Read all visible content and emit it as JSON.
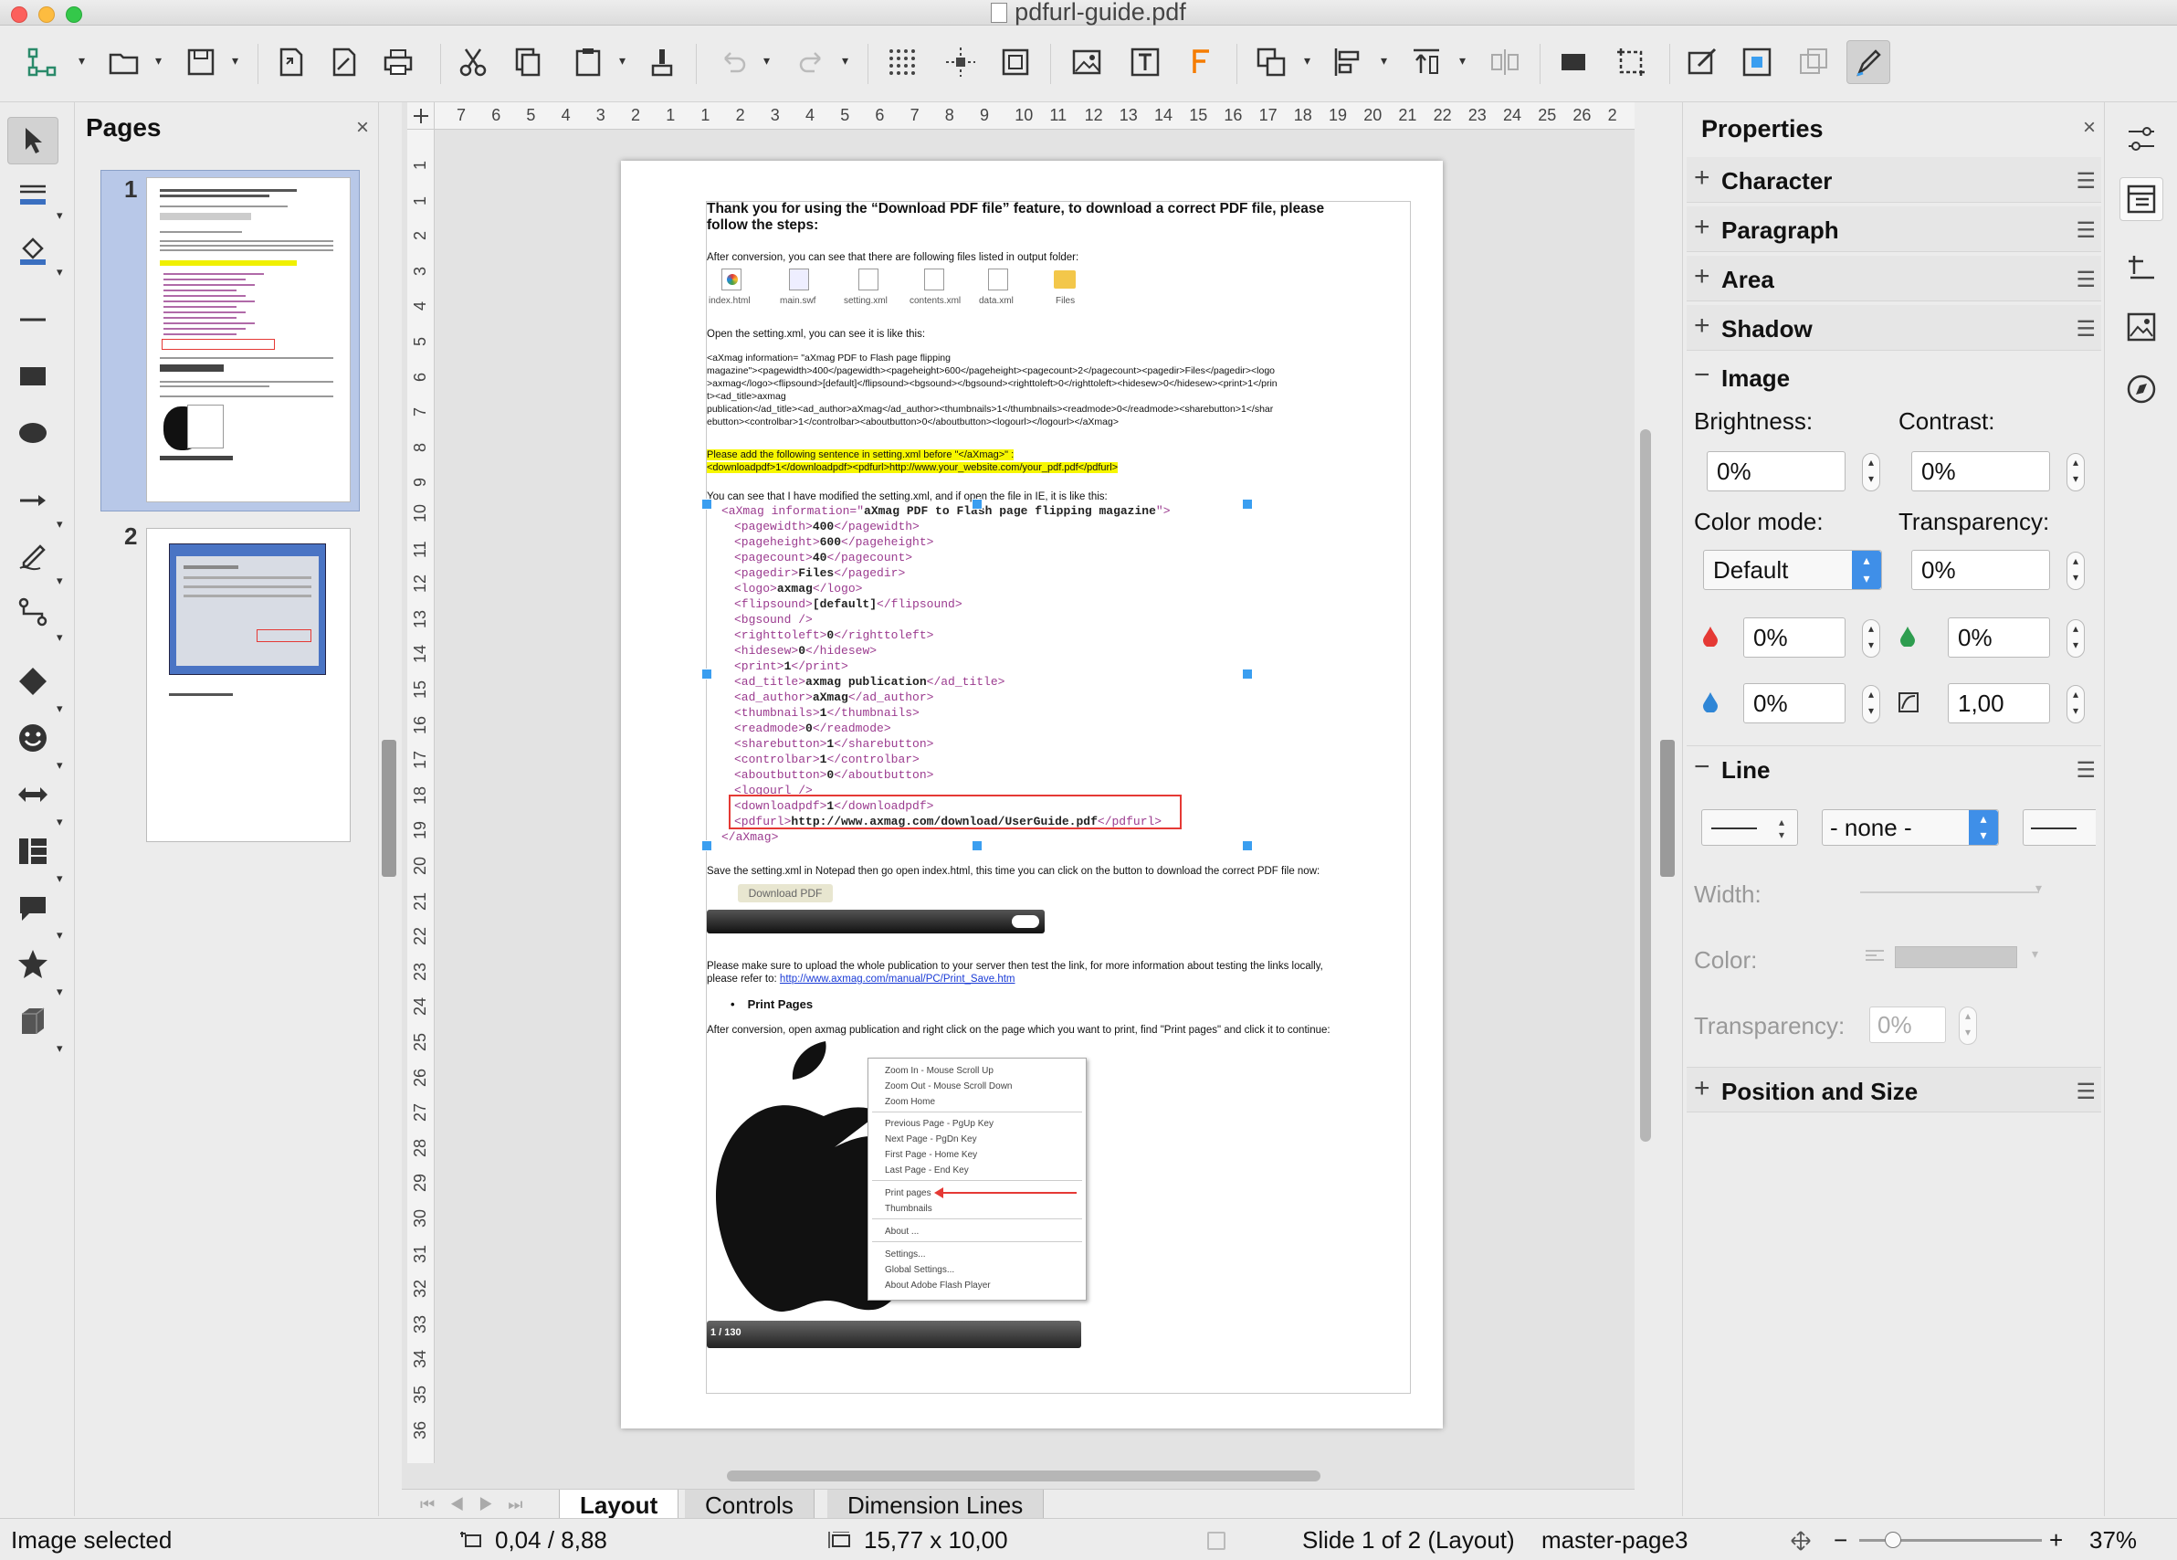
{
  "window": {
    "title": "pdfurl-guide.pdf"
  },
  "pages_panel": {
    "title": "Pages",
    "close": "×",
    "page_numbers": [
      "1",
      "2"
    ]
  },
  "ruler": {
    "h_ticks": [
      "7",
      "6",
      "5",
      "4",
      "3",
      "2",
      "1",
      "1",
      "2",
      "3",
      "4",
      "5",
      "6",
      "7",
      "8",
      "9",
      "10",
      "11",
      "12",
      "13",
      "14",
      "15",
      "16",
      "17",
      "18",
      "19",
      "20",
      "21",
      "22",
      "23",
      "24",
      "25",
      "26",
      "2"
    ],
    "v_ticks": [
      "1",
      "1",
      "2",
      "3",
      "4",
      "5",
      "6",
      "7",
      "8",
      "9",
      "10",
      "11",
      "12",
      "13",
      "14",
      "15",
      "16",
      "17",
      "18",
      "19",
      "20",
      "21",
      "22",
      "23",
      "24",
      "25",
      "26",
      "27",
      "28",
      "29",
      "30",
      "31",
      "32",
      "33",
      "34",
      "35",
      "36"
    ]
  },
  "document": {
    "heading": "Thank you for using the “Download PDF file” feature, to download a correct PDF file, please follow the steps:",
    "after_conversion": "After conversion, you can see that there are following files listed in output folder:",
    "files": [
      "index.html",
      "main.swf",
      "setting.xml",
      "contents.xml",
      "data.xml",
      "Files"
    ],
    "open_setting": "Open the setting.xml, you can see it is like this:",
    "xml_raw": [
      "<aXmag information= \"aXmag PDF to Flash page flipping",
      "magazine\"><pagewidth>400</pagewidth><pageheight>600</pageheight><pagecount>2</pagecount><pagedir>Files</pagedir><logo",
      ">axmag</logo><flipsound>[default]</flipsound><bgsound></bgsound><righttoleft>0</righttoleft><hidesew>0</hidesew><print>1</prin",
      "t><ad_title>axmag",
      "publication</ad_title><ad_author>aXmag</ad_author><thumbnails>1</thumbnails><readmode>0</readmode><sharebutton>1</shar",
      "ebutton><controlbar>1</controlbar><aboutbutton>0</aboutbutton><logourl></logourl></aXmag>"
    ],
    "highlight_lines": [
      "Please add the following sentence in setting.xml before \"</aXmag>\" :",
      "<downloadpdf>1</downloadpdf><pdfurl>http://www.your_website.com/your_pdf.pdf</pdfurl>"
    ],
    "modified_note": "You can see that I have modified the setting.xml, and if open the file in IE, it is like this:",
    "xml_tree": [
      {
        "o": "<aXmag information=\"",
        "v": "aXmag PDF to Flash page flipping magazine",
        "c": "\">"
      },
      {
        "o": "<pagewidth>",
        "v": "400",
        "c": "</pagewidth>"
      },
      {
        "o": "<pageheight>",
        "v": "600",
        "c": "</pageheight>"
      },
      {
        "o": "<pagecount>",
        "v": "40",
        "c": "</pagecount>"
      },
      {
        "o": "<pagedir>",
        "v": "Files",
        "c": "</pagedir>"
      },
      {
        "o": "<logo>",
        "v": "axmag",
        "c": "</logo>"
      },
      {
        "o": "<flipsound>",
        "v": "[default]",
        "c": "</flipsound>"
      },
      {
        "o": "<bgsound />",
        "v": "",
        "c": ""
      },
      {
        "o": "<righttoleft>",
        "v": "0",
        "c": "</righttoleft>"
      },
      {
        "o": "<hidesew>",
        "v": "0",
        "c": "</hidesew>"
      },
      {
        "o": "<print>",
        "v": "1",
        "c": "</print>"
      },
      {
        "o": "<ad_title>",
        "v": "axmag publication",
        "c": "</ad_title>"
      },
      {
        "o": "<ad_author>",
        "v": "aXmag",
        "c": "</ad_author>"
      },
      {
        "o": "<thumbnails>",
        "v": "1",
        "c": "</thumbnails>"
      },
      {
        "o": "<readmode>",
        "v": "0",
        "c": "</readmode>"
      },
      {
        "o": "<sharebutton>",
        "v": "1",
        "c": "</sharebutton>"
      },
      {
        "o": "<controlbar>",
        "v": "1",
        "c": "</controlbar>"
      },
      {
        "o": "<aboutbutton>",
        "v": "0",
        "c": "</aboutbutton>"
      },
      {
        "o": "<logourl />",
        "v": "",
        "c": ""
      },
      {
        "o": "<downloadpdf>",
        "v": "1",
        "c": "</downloadpdf>"
      },
      {
        "o": "<pdfurl>",
        "v": "http://www.axmag.com/download/UserGuide.pdf",
        "c": "</pdfurl>"
      },
      {
        "o": "</aXmag>",
        "v": "",
        "c": ""
      }
    ],
    "save_note": "Save the setting.xml in Notepad then go open index.html, this time you can click on the button to download the correct PDF file now:",
    "download_button": "Download PDF",
    "upload_note": "Please make sure to upload the whole publication to your server then test the link, for more information about testing the links locally,",
    "refer_label": "please refer to:",
    "refer_link": "http://www.axmag.com/manual/PC/Print_Save.htm",
    "bullet": "Print Pages",
    "print_note": "After conversion, open axmag publication and right click on the page which you want to print, find \"Print pages\" and click it to continue:",
    "context_menu": [
      "Zoom In - Mouse Scroll Up",
      "Zoom Out - Mouse Scroll Down",
      "Zoom Home",
      "Previous Page - PgUp Key",
      "Next Page - PgDn Key",
      "First Page - Home Key",
      "Last Page - End Key",
      "Print pages",
      "Thumbnails",
      "About ...",
      "Settings...",
      "Global Settings...",
      "About Adobe Flash Player"
    ],
    "page_counter": "1 / 130"
  },
  "properties": {
    "title": "Properties",
    "close": "×",
    "sections": {
      "character": "Character",
      "paragraph": "Paragraph",
      "area": "Area",
      "shadow": "Shadow",
      "image": "Image",
      "line": "Line",
      "position": "Position and Size"
    },
    "brightness_label": "Brightness:",
    "brightness": "0%",
    "contrast_label": "Contrast:",
    "contrast": "0%",
    "colormode_label": "Color mode:",
    "colormode": "Default",
    "transparency_label": "Transparency:",
    "transparency": "0%",
    "red": "0%",
    "green": "0%",
    "blue": "0%",
    "gamma": "1,00",
    "line_style": "- none -",
    "width_label": "Width:",
    "color_label": "Color:",
    "line_transparency_label": "Transparency:",
    "line_transparency": "0%"
  },
  "tabs": [
    "Layout",
    "Controls",
    "Dimension Lines"
  ],
  "status": {
    "selection": "Image selected",
    "position": "0,04 / 8,88",
    "size": "15,77 x 10,00",
    "slide": "Slide 1 of 2 (Layout)",
    "master": "master-page3",
    "zoom_minus": "−",
    "zoom_plus": "+",
    "zoom": "37%"
  },
  "colors": {
    "selection_handle": "#3a9ef0",
    "highlight": "#f7f700",
    "red_box": "#e53935",
    "xml_tag": "#9b3b8f"
  }
}
